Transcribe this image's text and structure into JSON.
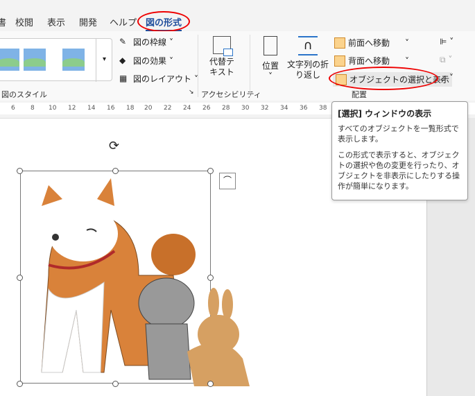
{
  "tabs": [
    {
      "label": "書"
    },
    {
      "label": "校閲"
    },
    {
      "label": "表示"
    },
    {
      "label": "開発"
    },
    {
      "label": "ヘルプ"
    },
    {
      "label": "図の形式"
    }
  ],
  "ribbon": {
    "styles_group": {
      "label": "図のスタイル",
      "border": "図の枠線",
      "effects": "図の効果",
      "layout": "図のレイアウト"
    },
    "accessibility": {
      "alt_text": "代替テ\nキスト",
      "label": "アクセシビリティ"
    },
    "arrange": {
      "position": "位置",
      "wrap": "文字列の折\nり返し",
      "bring_forward": "前面へ移動",
      "send_backward": "背面へ移動",
      "selection_pane": "オブジェクトの選択と表示",
      "label": "配置"
    }
  },
  "ruler": [
    "6",
    "8",
    "10",
    "12",
    "14",
    "16",
    "18",
    "20",
    "22",
    "24",
    "26",
    "28",
    "30",
    "32",
    "34",
    "36",
    "38"
  ],
  "tooltip": {
    "title": "[選択] ウィンドウの表示",
    "p1": "すべてのオブジェクトを一覧形式で表示します。",
    "p2": "この形式で表示すると、オブジェクトの選択や色の変更を行ったり、オブジェクトを非表示にしたりする操作が簡単になります。"
  },
  "colors": {
    "accent": "#1f4e9c",
    "highlight": "#e00000"
  }
}
